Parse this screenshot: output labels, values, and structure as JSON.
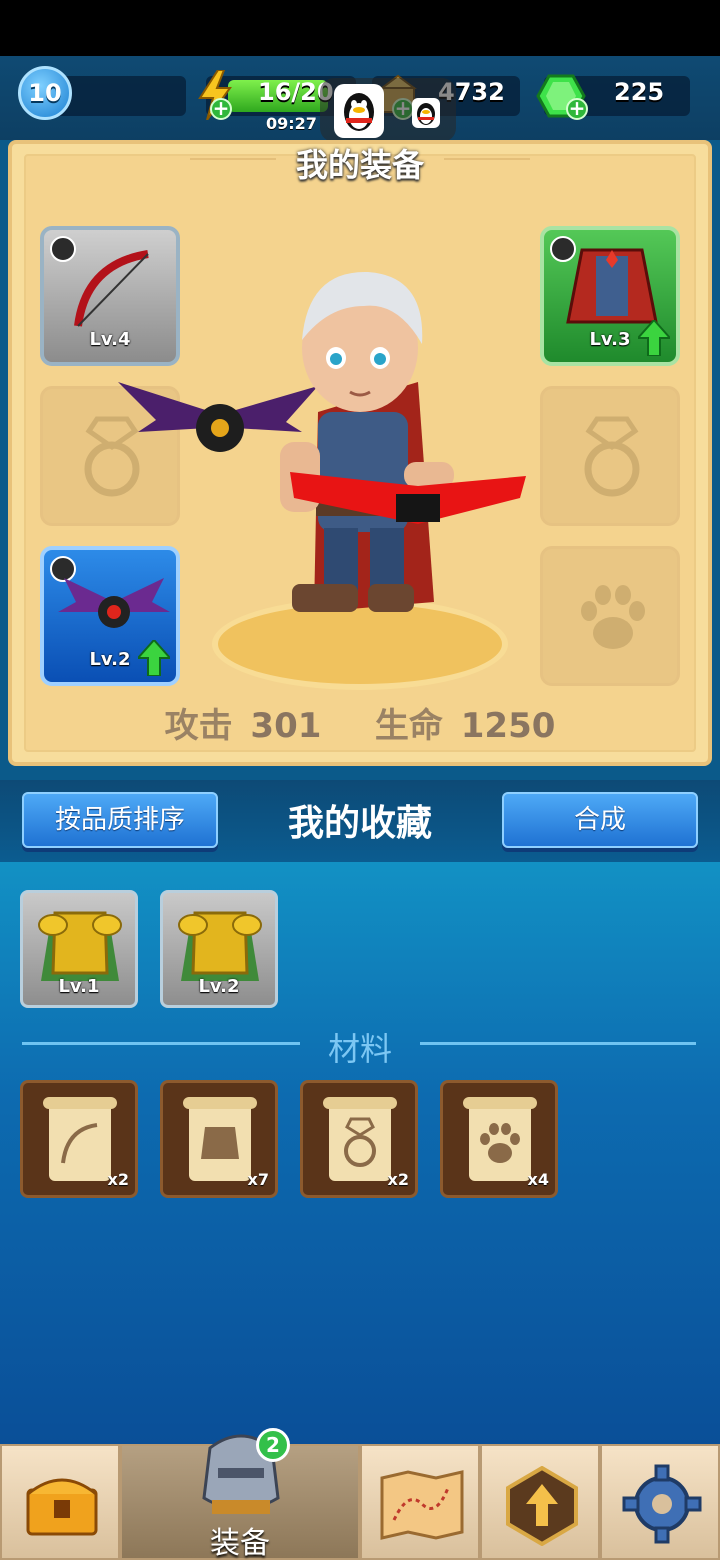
{
  "top_bar": {
    "level": "10",
    "energy": "16/20",
    "energy_timer": "09:27",
    "gold": "4732",
    "gems": "225"
  },
  "equipment": {
    "title": "我的装备",
    "slots": {
      "bow": {
        "level_label": "Lv.4"
      },
      "armor": {
        "level_label": "Lv.3"
      },
      "pet": {
        "level_label": "Lv.2"
      }
    },
    "stats": {
      "attack_label": "攻击",
      "attack_value": "301",
      "hp_label": "生命",
      "hp_value": "1250"
    }
  },
  "collection": {
    "sort_button": "按品质排序",
    "title": "我的收藏",
    "merge_button": "合成",
    "items": [
      {
        "level_label": "Lv.1"
      },
      {
        "level_label": "Lv.2"
      }
    ],
    "materials_label": "材料",
    "materials": [
      {
        "icon": "bow-scroll-icon",
        "count": "x2"
      },
      {
        "icon": "armor-scroll-icon",
        "count": "x7"
      },
      {
        "icon": "ring-scroll-icon",
        "count": "x2"
      },
      {
        "icon": "paw-scroll-icon",
        "count": "x4"
      }
    ]
  },
  "bottom_nav": {
    "active_label": "装备",
    "badge_count": "2"
  },
  "colors": {
    "panel_bg": "#f4d38e",
    "button_blue": "#2f86e0",
    "area_blue": "#0d6bb0",
    "nav_bg": "#8b7357"
  }
}
